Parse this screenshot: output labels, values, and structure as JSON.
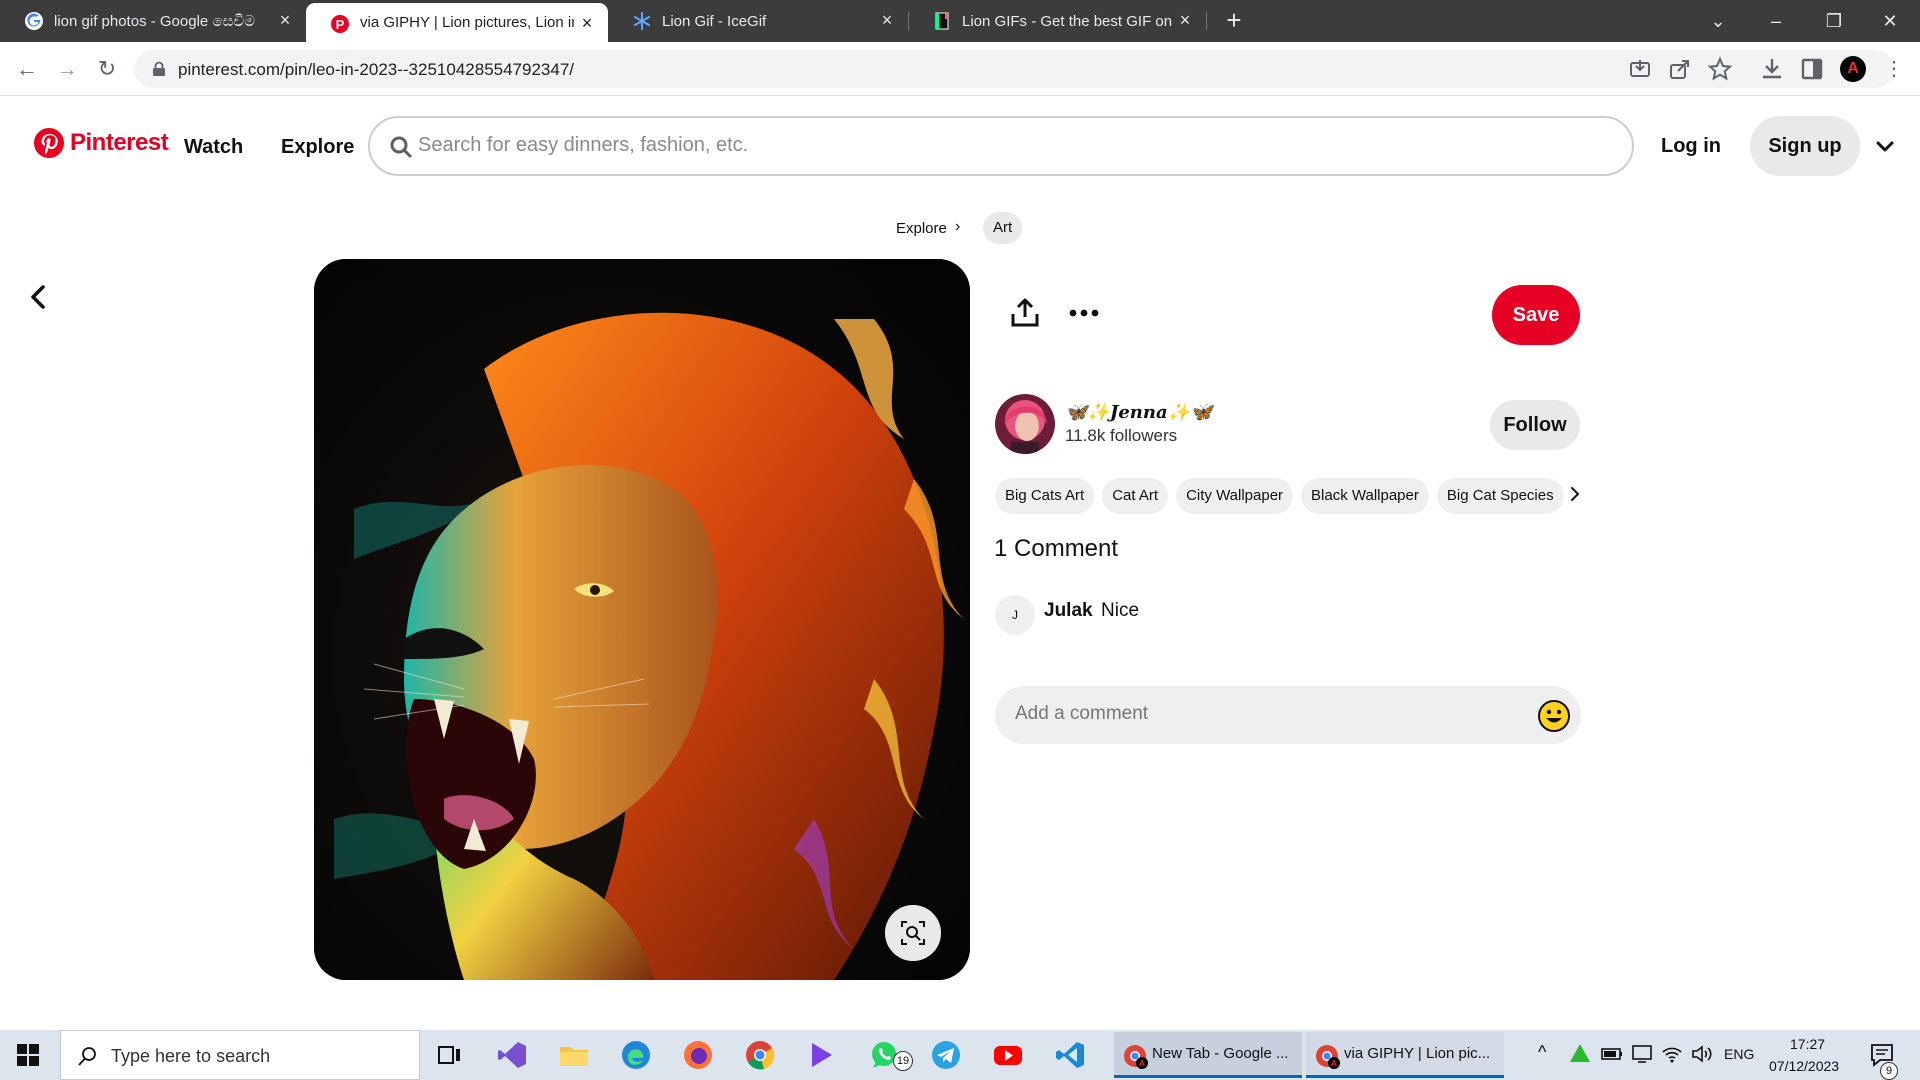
{
  "browser": {
    "tabs": [
      {
        "title": "lion gif photos - Google සෙවීම",
        "favicon": "google-icon",
        "active": false
      },
      {
        "title": "via GIPHY | Lion pictures, Lion im",
        "favicon": "pinterest-icon",
        "active": true
      },
      {
        "title": "Lion Gif - IceGif",
        "favicon": "snowflake-icon",
        "active": false
      },
      {
        "title": "Lion GIFs - Get the best GIF on G",
        "favicon": "giphy-icon",
        "active": false
      }
    ],
    "url": "pinterest.com/pin/leo-in-2023--32510428554792347/",
    "profile_initial": "A"
  },
  "header": {
    "logo_text": "Pinterest",
    "nav": {
      "watch": "Watch",
      "explore": "Explore"
    },
    "search_placeholder": "Search for easy dinners, fashion, etc.",
    "login": "Log in",
    "signup": "Sign up"
  },
  "breadcrumb": {
    "explore": "Explore",
    "separator": "›",
    "current": "Art"
  },
  "pin": {
    "save_label": "Save",
    "creator": {
      "name": "🦋✨𝑱𝒆𝒏𝒏𝒂✨🦋",
      "followers": "11.8k followers",
      "follow_label": "Follow"
    },
    "tags": [
      "Big Cats Art",
      "Cat Art",
      "City Wallpaper",
      "Black Wallpaper",
      "Big Cat Species"
    ],
    "comments_title": "1 Comment",
    "comments": [
      {
        "initial": "J",
        "author": "Julak",
        "text": "Nice"
      }
    ],
    "add_comment_placeholder": "Add a comment"
  },
  "taskbar": {
    "search_placeholder": "Type here to search",
    "windows": [
      {
        "label": "New Tab - Google ..."
      },
      {
        "label": "via GIPHY | Lion pic..."
      }
    ],
    "whatsapp_badge": "19",
    "language": "ENG",
    "time": "17:27",
    "date": "07/12/2023",
    "notification_count": "9"
  },
  "colors": {
    "pinterest_red": "#e60023",
    "chrome_dark": "#3c3c3c",
    "taskbar": "#dce4ee"
  }
}
